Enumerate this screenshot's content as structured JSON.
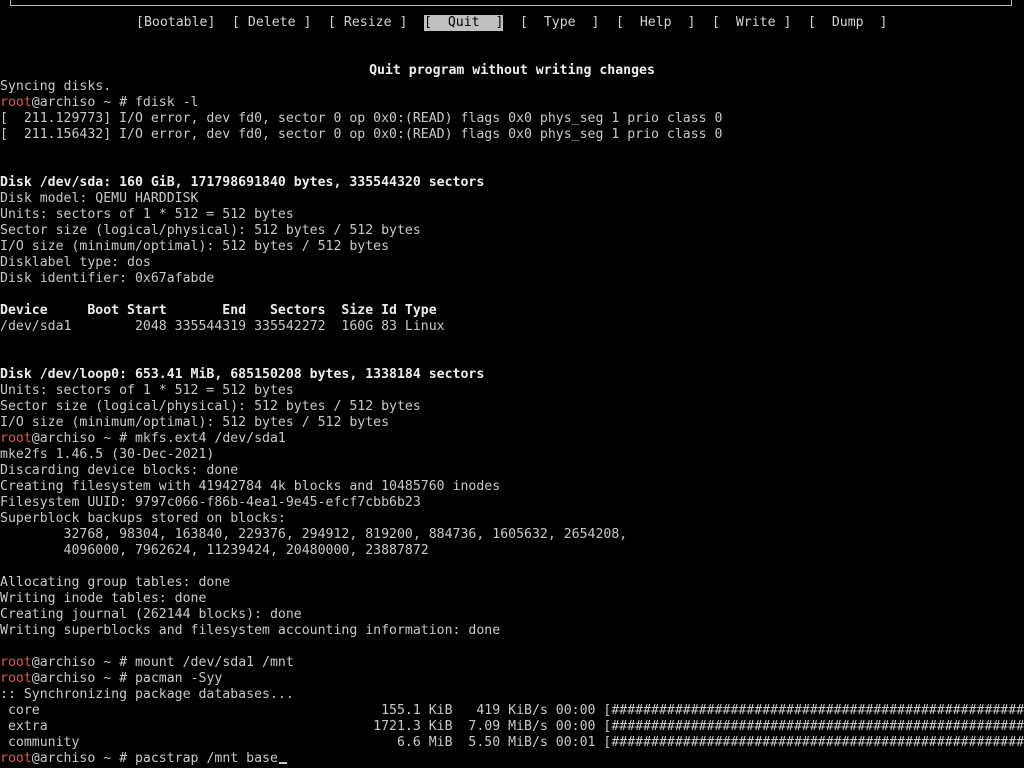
{
  "menu": {
    "items": [
      {
        "label": "[Bootable]",
        "selected": false
      },
      {
        "label": "[ Delete ]",
        "selected": false
      },
      {
        "label": "[ Resize ]",
        "selected": false
      },
      {
        "label": "[  Quit  ]",
        "selected": true
      },
      {
        "label": "[  Type  ]",
        "selected": false
      },
      {
        "label": "[  Help  ]",
        "selected": false
      },
      {
        "label": "[  Write ]",
        "selected": false
      },
      {
        "label": "[  Dump  ]",
        "selected": false
      }
    ]
  },
  "status": "Quit program without writing changes",
  "terminal": {
    "prompt_user": "root",
    "prompt_rest": "@archiso ~ # ",
    "lines": [
      {
        "t": "Syncing disks."
      },
      {
        "t": "fdisk -l",
        "p": true
      },
      {
        "t": "[  211.129773] I/O error, dev fd0, sector 0 op 0x0:(READ) flags 0x0 phys_seg 1 prio class 0"
      },
      {
        "t": "[  211.156432] I/O error, dev fd0, sector 0 op 0x0:(READ) flags 0x0 phys_seg 1 prio class 0"
      },
      {
        "t": ""
      },
      {
        "t": ""
      },
      {
        "t": "Disk /dev/sda: 160 GiB, 171798691840 bytes, 335544320 sectors",
        "b": true
      },
      {
        "t": "Disk model: QEMU HARDDISK"
      },
      {
        "t": "Units: sectors of 1 * 512 = 512 bytes"
      },
      {
        "t": "Sector size (logical/physical): 512 bytes / 512 bytes"
      },
      {
        "t": "I/O size (minimum/optimal): 512 bytes / 512 bytes"
      },
      {
        "t": "Disklabel type: dos"
      },
      {
        "t": "Disk identifier: 0x67afabde"
      },
      {
        "t": ""
      },
      {
        "t": "Device     Boot Start       End   Sectors  Size Id Type",
        "b": true
      },
      {
        "t": "/dev/sda1        2048 335544319 335542272  160G 83 Linux"
      },
      {
        "t": ""
      },
      {
        "t": ""
      },
      {
        "t": "Disk /dev/loop0: 653.41 MiB, 685150208 bytes, 1338184 sectors",
        "b": true
      },
      {
        "t": "Units: sectors of 1 * 512 = 512 bytes"
      },
      {
        "t": "Sector size (logical/physical): 512 bytes / 512 bytes"
      },
      {
        "t": "I/O size (minimum/optimal): 512 bytes / 512 bytes"
      },
      {
        "t": "mkfs.ext4 /dev/sda1",
        "p": true
      },
      {
        "t": "mke2fs 1.46.5 (30-Dec-2021)"
      },
      {
        "t": "Discarding device blocks: done"
      },
      {
        "t": "Creating filesystem with 41942784 4k blocks and 10485760 inodes"
      },
      {
        "t": "Filesystem UUID: 9797c066-f86b-4ea1-9e45-efcf7cbb6b23"
      },
      {
        "t": "Superblock backups stored on blocks:"
      },
      {
        "t": "        32768, 98304, 163840, 229376, 294912, 819200, 884736, 1605632, 2654208,"
      },
      {
        "t": "        4096000, 7962624, 11239424, 20480000, 23887872"
      },
      {
        "t": ""
      },
      {
        "t": "Allocating group tables: done"
      },
      {
        "t": "Writing inode tables: done"
      },
      {
        "t": "Creating journal (262144 blocks): done"
      },
      {
        "t": "Writing superblocks and filesystem accounting information: done"
      },
      {
        "t": ""
      },
      {
        "t": "mount /dev/sda1 /mnt",
        "p": true
      },
      {
        "t": "pacman -Syy",
        "p": true
      },
      {
        "t": ":: Synchronizing package databases..."
      },
      {
        "t": " core                                           155.1 KiB   419 KiB/s 00:00 [######################################################] 100%"
      },
      {
        "t": " extra                                         1721.3 KiB  7.09 MiB/s 00:00 [######################################################] 100%"
      },
      {
        "t": " community                                        6.6 MiB  5.50 MiB/s 00:01 [######################################################] 100%"
      },
      {
        "t": "pacstrap /mnt base",
        "p": true,
        "cursor": true
      }
    ]
  }
}
